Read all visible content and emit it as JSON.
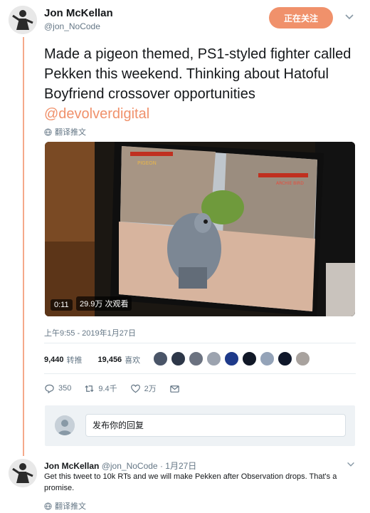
{
  "tweet": {
    "author_name": "Jon McKellan",
    "author_handle": "@jon_NoCode",
    "follow_label": "正在关注",
    "text_main": "Made a pigeon themed, PS1-styled fighter called Pekken this weekend. Thinking about Hatoful Boyfriend crossover opportunities ",
    "mention": "@devolverdigital",
    "translate_label": "翻译推文",
    "video": {
      "time": "0:11",
      "views": "29.9万 次观看"
    },
    "timestamp": "上午9:55 - 2019年1月27日",
    "retweets_count": "9,440",
    "retweets_label": "转推",
    "likes_count": "19,456",
    "likes_label": "喜欢",
    "liker_colors": [
      "#4a5568",
      "#2d3748",
      "#6b7280",
      "#9ca3af",
      "#1e3a8a",
      "#111827",
      "#94a3b8",
      "#0f172a",
      "#a8a29e"
    ],
    "actions": {
      "replies": "350",
      "retweets": "9.4千",
      "likes": "2万"
    }
  },
  "reply_box": {
    "placeholder": "发布你的回复"
  },
  "reply": {
    "author_name": "Jon McKellan",
    "author_handle": "@jon_NoCode",
    "date": "· 1月27日",
    "text": "Get this tweet to 10k RTs and we will make Pekken after Observation drops. That's a promise.",
    "translate_label": "翻译推文"
  },
  "colors": {
    "accent": "#f0916b",
    "muted": "#657786",
    "thread": "#f5a98a"
  }
}
